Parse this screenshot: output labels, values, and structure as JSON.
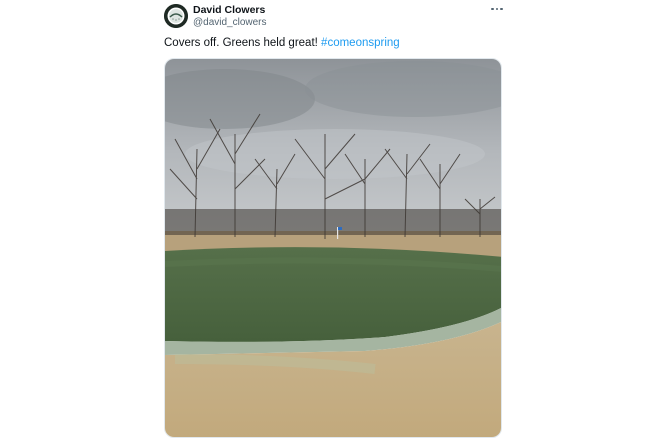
{
  "author": {
    "display_name": "David Clowers",
    "handle": "@david_clowers",
    "avatar_icon": "golf-ball-avatar-icon"
  },
  "menu": {
    "icon": "more-options-icon"
  },
  "tweet": {
    "text": "Covers off. Greens held great! ",
    "hashtag": "#comeonspring",
    "hashtag_color": "#1d9bf0"
  },
  "media": {
    "type": "photo",
    "icon": "golf-green-photo"
  }
}
